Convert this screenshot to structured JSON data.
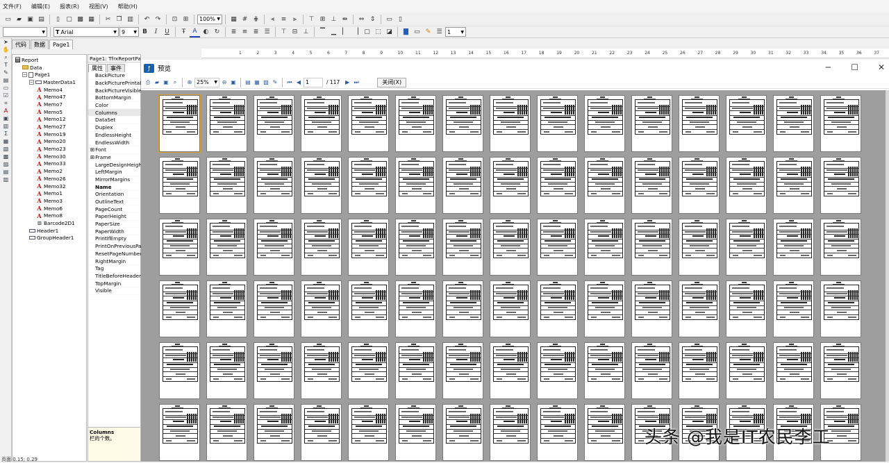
{
  "menubar": {
    "items": [
      "文件(F)",
      "编辑(E)",
      "报表(R)",
      "视图(V)",
      "帮助(H)"
    ]
  },
  "toolbar": {
    "zoom_value": "100%"
  },
  "format_bar": {
    "font_name": "Arial",
    "font_size": "9",
    "bold_label": "B",
    "italic_label": "I",
    "underline_label": "U",
    "frame_width": "1"
  },
  "design_tabs": [
    "代码",
    "数据",
    "Page1"
  ],
  "tree": [
    {
      "label": "Report",
      "level": 0,
      "icon": "report-icon"
    },
    {
      "label": "Data",
      "level": 1,
      "icon": "folder-icon"
    },
    {
      "label": "Page1",
      "level": 1,
      "icon": "page-icon",
      "expander": "−"
    },
    {
      "label": "MasterData1",
      "level": 2,
      "icon": "band-icon",
      "expander": "−"
    },
    {
      "label": "Memo4",
      "level": 3,
      "icon": "memo-icon"
    },
    {
      "label": "Memo47",
      "level": 3,
      "icon": "memo-icon"
    },
    {
      "label": "Memo7",
      "level": 3,
      "icon": "memo-icon"
    },
    {
      "label": "Memo5",
      "level": 3,
      "icon": "memo-icon"
    },
    {
      "label": "Memo12",
      "level": 3,
      "icon": "memo-icon"
    },
    {
      "label": "Memo27",
      "level": 3,
      "icon": "memo-icon"
    },
    {
      "label": "Memo19",
      "level": 3,
      "icon": "memo-icon"
    },
    {
      "label": "Memo20",
      "level": 3,
      "icon": "memo-icon"
    },
    {
      "label": "Memo23",
      "level": 3,
      "icon": "memo-icon"
    },
    {
      "label": "Memo30",
      "level": 3,
      "icon": "memo-icon"
    },
    {
      "label": "Memo33",
      "level": 3,
      "icon": "memo-icon"
    },
    {
      "label": "Memo2",
      "level": 3,
      "icon": "memo-icon"
    },
    {
      "label": "Memo26",
      "level": 3,
      "icon": "memo-icon"
    },
    {
      "label": "Memo32",
      "level": 3,
      "icon": "memo-icon"
    },
    {
      "label": "Memo1",
      "level": 3,
      "icon": "memo-icon"
    },
    {
      "label": "Memo3",
      "level": 3,
      "icon": "memo-icon"
    },
    {
      "label": "Memo6",
      "level": 3,
      "icon": "memo-icon"
    },
    {
      "label": "Memo8",
      "level": 3,
      "icon": "memo-icon"
    },
    {
      "label": "Barcode2D1",
      "level": 3,
      "icon": "barcode-icon"
    },
    {
      "label": "Header1",
      "level": 2,
      "icon": "band-icon"
    },
    {
      "label": "GroupHeader1",
      "level": 2,
      "icon": "band-icon"
    }
  ],
  "inspector": {
    "title": "Page1: TfrxReportPage",
    "tabs": [
      "属性",
      "事件"
    ],
    "properties": [
      {
        "name": "BackPicture"
      },
      {
        "name": "BackPicturePrintable"
      },
      {
        "name": "BackPictureVisible"
      },
      {
        "name": "BottomMargin"
      },
      {
        "name": "Color"
      },
      {
        "name": "Columns",
        "selected": true
      },
      {
        "name": "DataSet"
      },
      {
        "name": "Duplex"
      },
      {
        "name": "EndlessHeight"
      },
      {
        "name": "EndlessWidth"
      },
      {
        "name": "Font",
        "group": "⊞"
      },
      {
        "name": "Frame",
        "group": "⊞"
      },
      {
        "name": "LargeDesignHeight"
      },
      {
        "name": "LeftMargin"
      },
      {
        "name": "MirrorMargins"
      },
      {
        "name": "Name",
        "bold": true
      },
      {
        "name": "Orientation"
      },
      {
        "name": "OutlineText"
      },
      {
        "name": "PageCount"
      },
      {
        "name": "PaperHeight"
      },
      {
        "name": "PaperSize"
      },
      {
        "name": "PaperWidth"
      },
      {
        "name": "PrintIfEmpty"
      },
      {
        "name": "PrintOnPreviousPage"
      },
      {
        "name": "ResetPageNumbers"
      },
      {
        "name": "RightMargin"
      },
      {
        "name": "Tag"
      },
      {
        "name": "TitleBeforeHeader"
      },
      {
        "name": "TopMargin"
      },
      {
        "name": "Visible"
      }
    ],
    "help_title": "Columns",
    "help_text": "栏的个数。"
  },
  "ruler": {
    "labels": [
      "1",
      "2",
      "3",
      "4",
      "5",
      "6",
      "7",
      "8",
      "9",
      "10",
      "11",
      "12",
      "13",
      "14",
      "15",
      "16",
      "17",
      "18",
      "19",
      "20",
      "21",
      "22",
      "23",
      "24",
      "25",
      "26",
      "27",
      "28",
      "29",
      "30",
      "31",
      "32",
      "33",
      "34",
      "35",
      "36",
      "37"
    ]
  },
  "preview": {
    "title": "预览",
    "zoom": "25%",
    "page_current": "1",
    "page_total": "/ 117",
    "close_label": "关闭(X)",
    "columns": 15,
    "rows": 6
  },
  "status": {
    "text": "页面     0.15; 0.29"
  },
  "watermark": "头条 @我是IT农民李工"
}
